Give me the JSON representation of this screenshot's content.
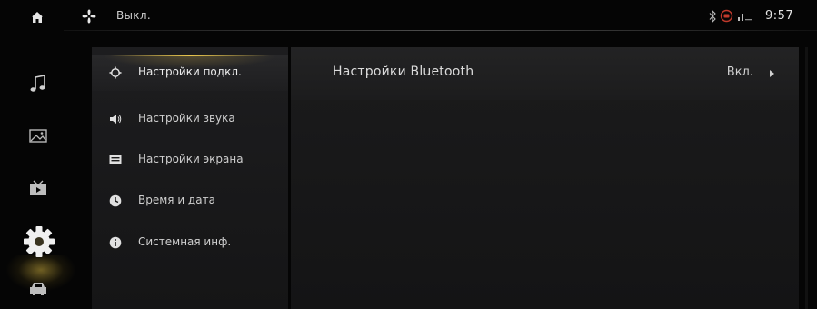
{
  "statusbar": {
    "climate_status": "Выкл.",
    "time": "9:57",
    "icons": [
      "home-icon",
      "fan-icon",
      "bluetooth-icon",
      "signal-icon",
      "network-icon"
    ]
  },
  "rail": {
    "items": [
      {
        "name": "music",
        "icon": "music-note-icon"
      },
      {
        "name": "gallery",
        "icon": "image-icon"
      },
      {
        "name": "video",
        "icon": "video-icon"
      },
      {
        "name": "settings",
        "icon": "gear-icon",
        "active": true
      },
      {
        "name": "vehicle",
        "icon": "car-icon"
      }
    ]
  },
  "menu": {
    "items": [
      {
        "label": "Настройки подкл.",
        "icon": "connection-icon",
        "selected": true
      },
      {
        "label": "Настройки звука",
        "icon": "speaker-icon"
      },
      {
        "label": "Настройки экрана",
        "icon": "screen-icon"
      },
      {
        "label": "Время и дата",
        "icon": "clock-icon"
      },
      {
        "label": "Системная инф.",
        "icon": "info-icon"
      }
    ]
  },
  "content": {
    "rows": [
      {
        "label": "Настройки Bluetooth",
        "value": "Вкл."
      }
    ]
  },
  "colors": {
    "accent": "#e8c64e",
    "background": "#050505",
    "panel": "#1b1b1c"
  }
}
